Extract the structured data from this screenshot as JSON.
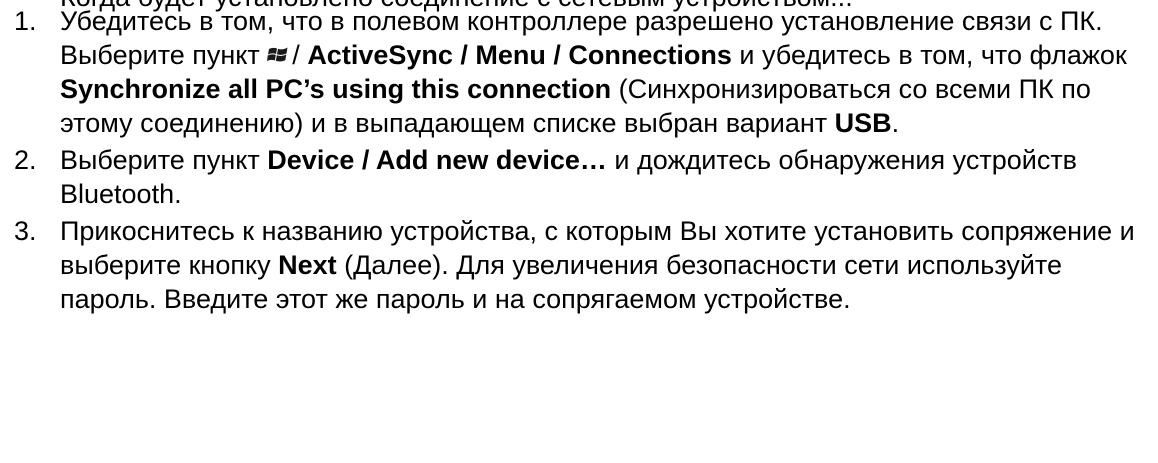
{
  "cut_line": "Когда будет установлено соединение с сетевым устройством...",
  "steps": [
    {
      "num": "1.",
      "t1": "Убедитесь в том, что в полевом контроллере разрешено установление связи с ПК. Выберите пункт ",
      "icon": "windows-flag-icon",
      "t2": "/ ",
      "b1": "ActiveSync / Menu / Connections",
      "t3": " и убедитесь в том, что флажок ",
      "b2": "Synchronize all PC’s using this connection",
      "t4": " (Синхронизироваться со всеми ПК по этому соединению) и в выпадающем списке выбран вариант ",
      "b3": "USB",
      "t5": "."
    },
    {
      "num": "2.",
      "t1": "Выберите пункт ",
      "b1": "Device / Add new device…",
      "t2": " и дождитесь обнаружения устройств Bluetooth."
    },
    {
      "num": "3.",
      "t1": "Прикоснитесь к названию устройства, с которым Вы хотите установить сопряжение и выберите кнопку ",
      "b1": "Next",
      "t2": " (Далее). Для увеличения безопасности сети используйте пароль. Введите этот же пароль и на сопрягаемом устройстве."
    }
  ]
}
